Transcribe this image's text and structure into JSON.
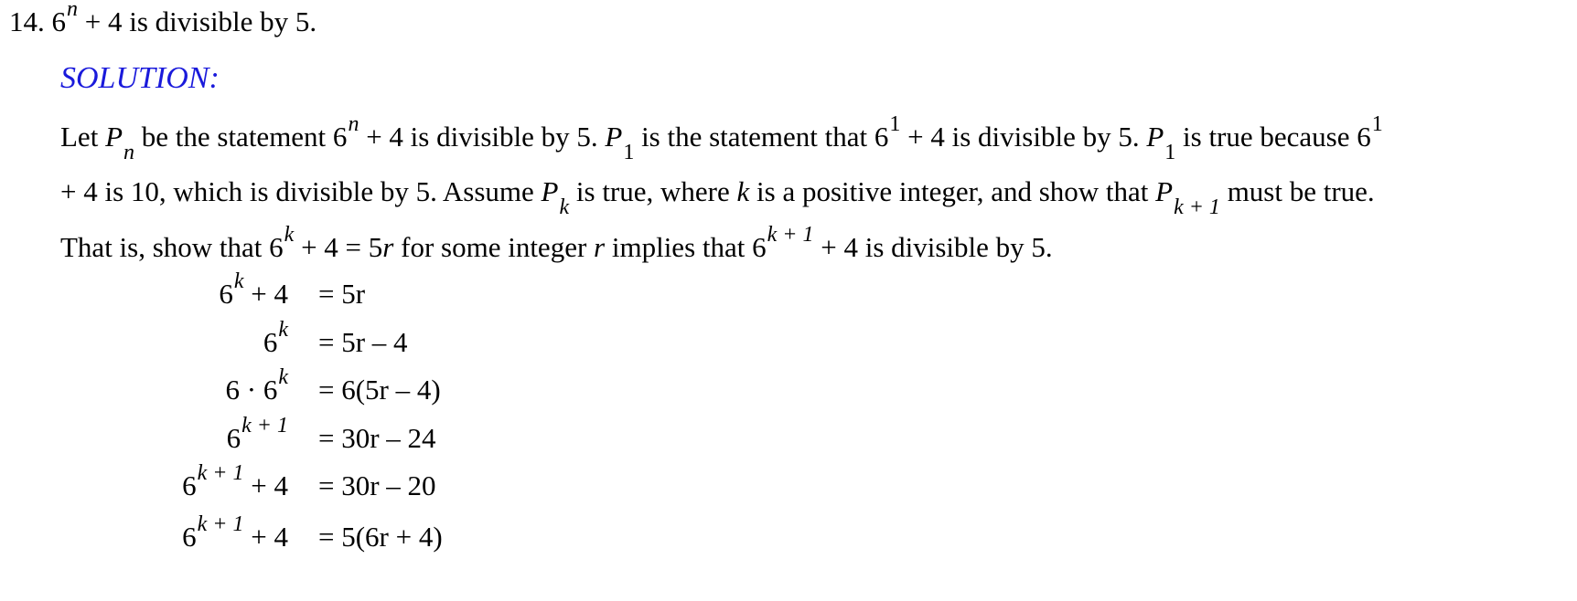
{
  "problem": {
    "number": "14.",
    "base": "6",
    "exp": "n",
    "rest": " + 4 is divisible by 5."
  },
  "solution_heading": "SOLUTION:",
  "paragraph": {
    "line1": {
      "t1": "Let ",
      "P": "P",
      "sub_n": "n",
      "t2": " be the statement 6",
      "sup_n": "n",
      "t3": " + 4 is divisible by 5. ",
      "P1a": "P",
      "sub_1a": "1",
      "t4": " is the statement that 6",
      "sup_1a": "1",
      "t5": " + 4 is divisible by 5. ",
      "P1b": "P",
      "sub_1b": "1",
      "t6": " is true because 6",
      "sup_1b": "1"
    },
    "line2": {
      "t1": "+ 4 is 10, which is divisible by 5. Assume ",
      "P": "P",
      "sub_k": "k",
      "t2": " is true, where ",
      "k": "k",
      "t3": " is a positive integer, and show that ",
      "P2": "P",
      "sub_k1": "k + 1",
      "t4": " must be true."
    },
    "line3": {
      "t1": "That is, show that 6",
      "sup_k": "k",
      "t2": " + 4 = 5",
      "r1": "r",
      "t3": " for some integer ",
      "r2": "r",
      "t4": " implies that 6",
      "sup_k1": "k + 1",
      "t5": " + 4 is divisible by 5."
    }
  },
  "equations": [
    {
      "left_base": "6",
      "left_exp": "k",
      "left_tail": " + 4",
      "right": "= 5r"
    },
    {
      "left_base": "6",
      "left_exp": "k",
      "left_tail": "",
      "right": "= 5r – 4"
    },
    {
      "left_base": "6 · 6",
      "left_exp": "k",
      "left_tail": "",
      "right": "= 6(5r – 4)"
    },
    {
      "left_base": "6",
      "left_exp": "k + 1",
      "left_tail": "",
      "right": "= 30r – 24"
    },
    {
      "left_base": "6",
      "left_exp": "k + 1",
      "left_tail": " + 4",
      "right": "= 30r – 20"
    },
    {
      "left_base": "6",
      "left_exp": "k + 1",
      "left_tail": " + 4",
      "right": "= 5(6r + 4)"
    }
  ]
}
